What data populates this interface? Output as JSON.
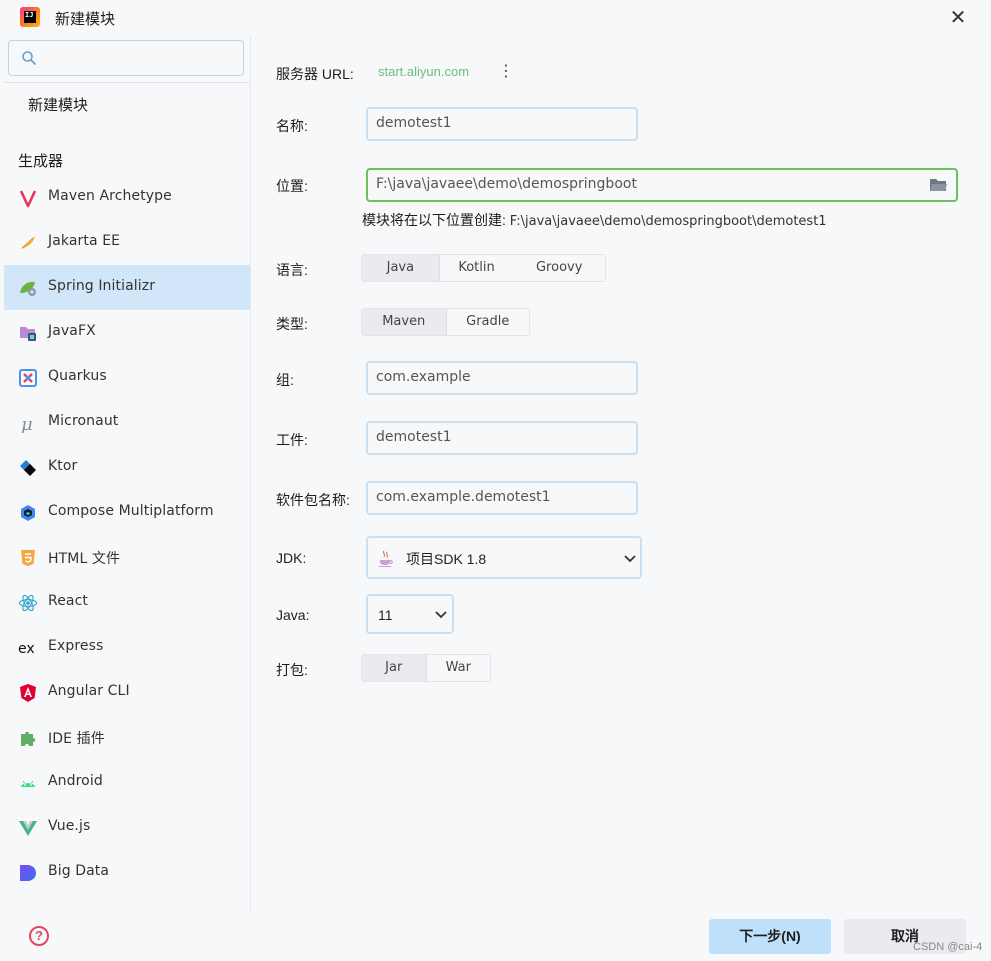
{
  "window": {
    "title": "新建模块",
    "close_symbol": "✕"
  },
  "sidebar": {
    "search": {
      "placeholder": "",
      "value": ""
    },
    "new_module": "新建模块",
    "generators_label": "生成器",
    "items": [
      {
        "label": "Maven Archetype",
        "icon": "maven-icon"
      },
      {
        "label": "Jakarta EE",
        "icon": "jakarta-icon"
      },
      {
        "label": "Spring Initializr",
        "icon": "spring-icon",
        "selected": true
      },
      {
        "label": "JavaFX",
        "icon": "javafx-icon"
      },
      {
        "label": "Quarkus",
        "icon": "quarkus-icon"
      },
      {
        "label": "Micronaut",
        "icon": "micronaut-icon"
      },
      {
        "label": "Ktor",
        "icon": "ktor-icon"
      },
      {
        "label": "Compose Multiplatform",
        "icon": "compose-icon"
      },
      {
        "label": "HTML 文件",
        "icon": "html5-icon"
      },
      {
        "label": "React",
        "icon": "react-icon"
      },
      {
        "label": "Express",
        "icon": "express-icon"
      },
      {
        "label": "Angular CLI",
        "icon": "angular-icon"
      },
      {
        "label": "IDE 插件",
        "icon": "puzzle-icon"
      },
      {
        "label": "Android",
        "icon": "android-icon"
      },
      {
        "label": "Vue.js",
        "icon": "vue-icon"
      },
      {
        "label": "Big Data",
        "icon": "bigdata-icon"
      }
    ],
    "help_symbol": "?"
  },
  "form": {
    "server_url_label": "服务器 URL:",
    "server_url_value": "start.aliyun.com",
    "name_label": "名称:",
    "name_value": "demotest1",
    "location_label": "位置:",
    "location_value": "F:\\java\\javaee\\demo\\demospringboot",
    "location_hint_prefix": "模块将在以下位置创建: ",
    "location_hint_path": "F:\\java\\javaee\\demo\\demospringboot\\demotest1",
    "language_label": "语言:",
    "language_options": [
      "Java",
      "Kotlin",
      "Groovy"
    ],
    "language_selected": "Java",
    "type_label": "类型:",
    "type_options": [
      "Maven",
      "Gradle"
    ],
    "type_selected": "Maven",
    "group_label": "组:",
    "group_value": "com.example",
    "artifact_label": "工件:",
    "artifact_value": "demotest1",
    "package_label": "软件包名称:",
    "package_value": "com.example.demotest1",
    "jdk_label": "JDK:",
    "jdk_value": "项目SDK 1.8",
    "java_label": "Java:",
    "java_value": "11",
    "packaging_label": "打包:",
    "packaging_options": [
      "Jar",
      "War"
    ],
    "packaging_selected": "Jar"
  },
  "footer": {
    "next_label": "下一步(N)",
    "cancel_label": "取消"
  },
  "watermark": "CSDN @cai-4",
  "colors": {
    "selected_bg": "#d2e6fa",
    "focus_border": "#6cc05f",
    "url_green": "#6cbf7a",
    "primary_button": "#bfe0fb"
  }
}
